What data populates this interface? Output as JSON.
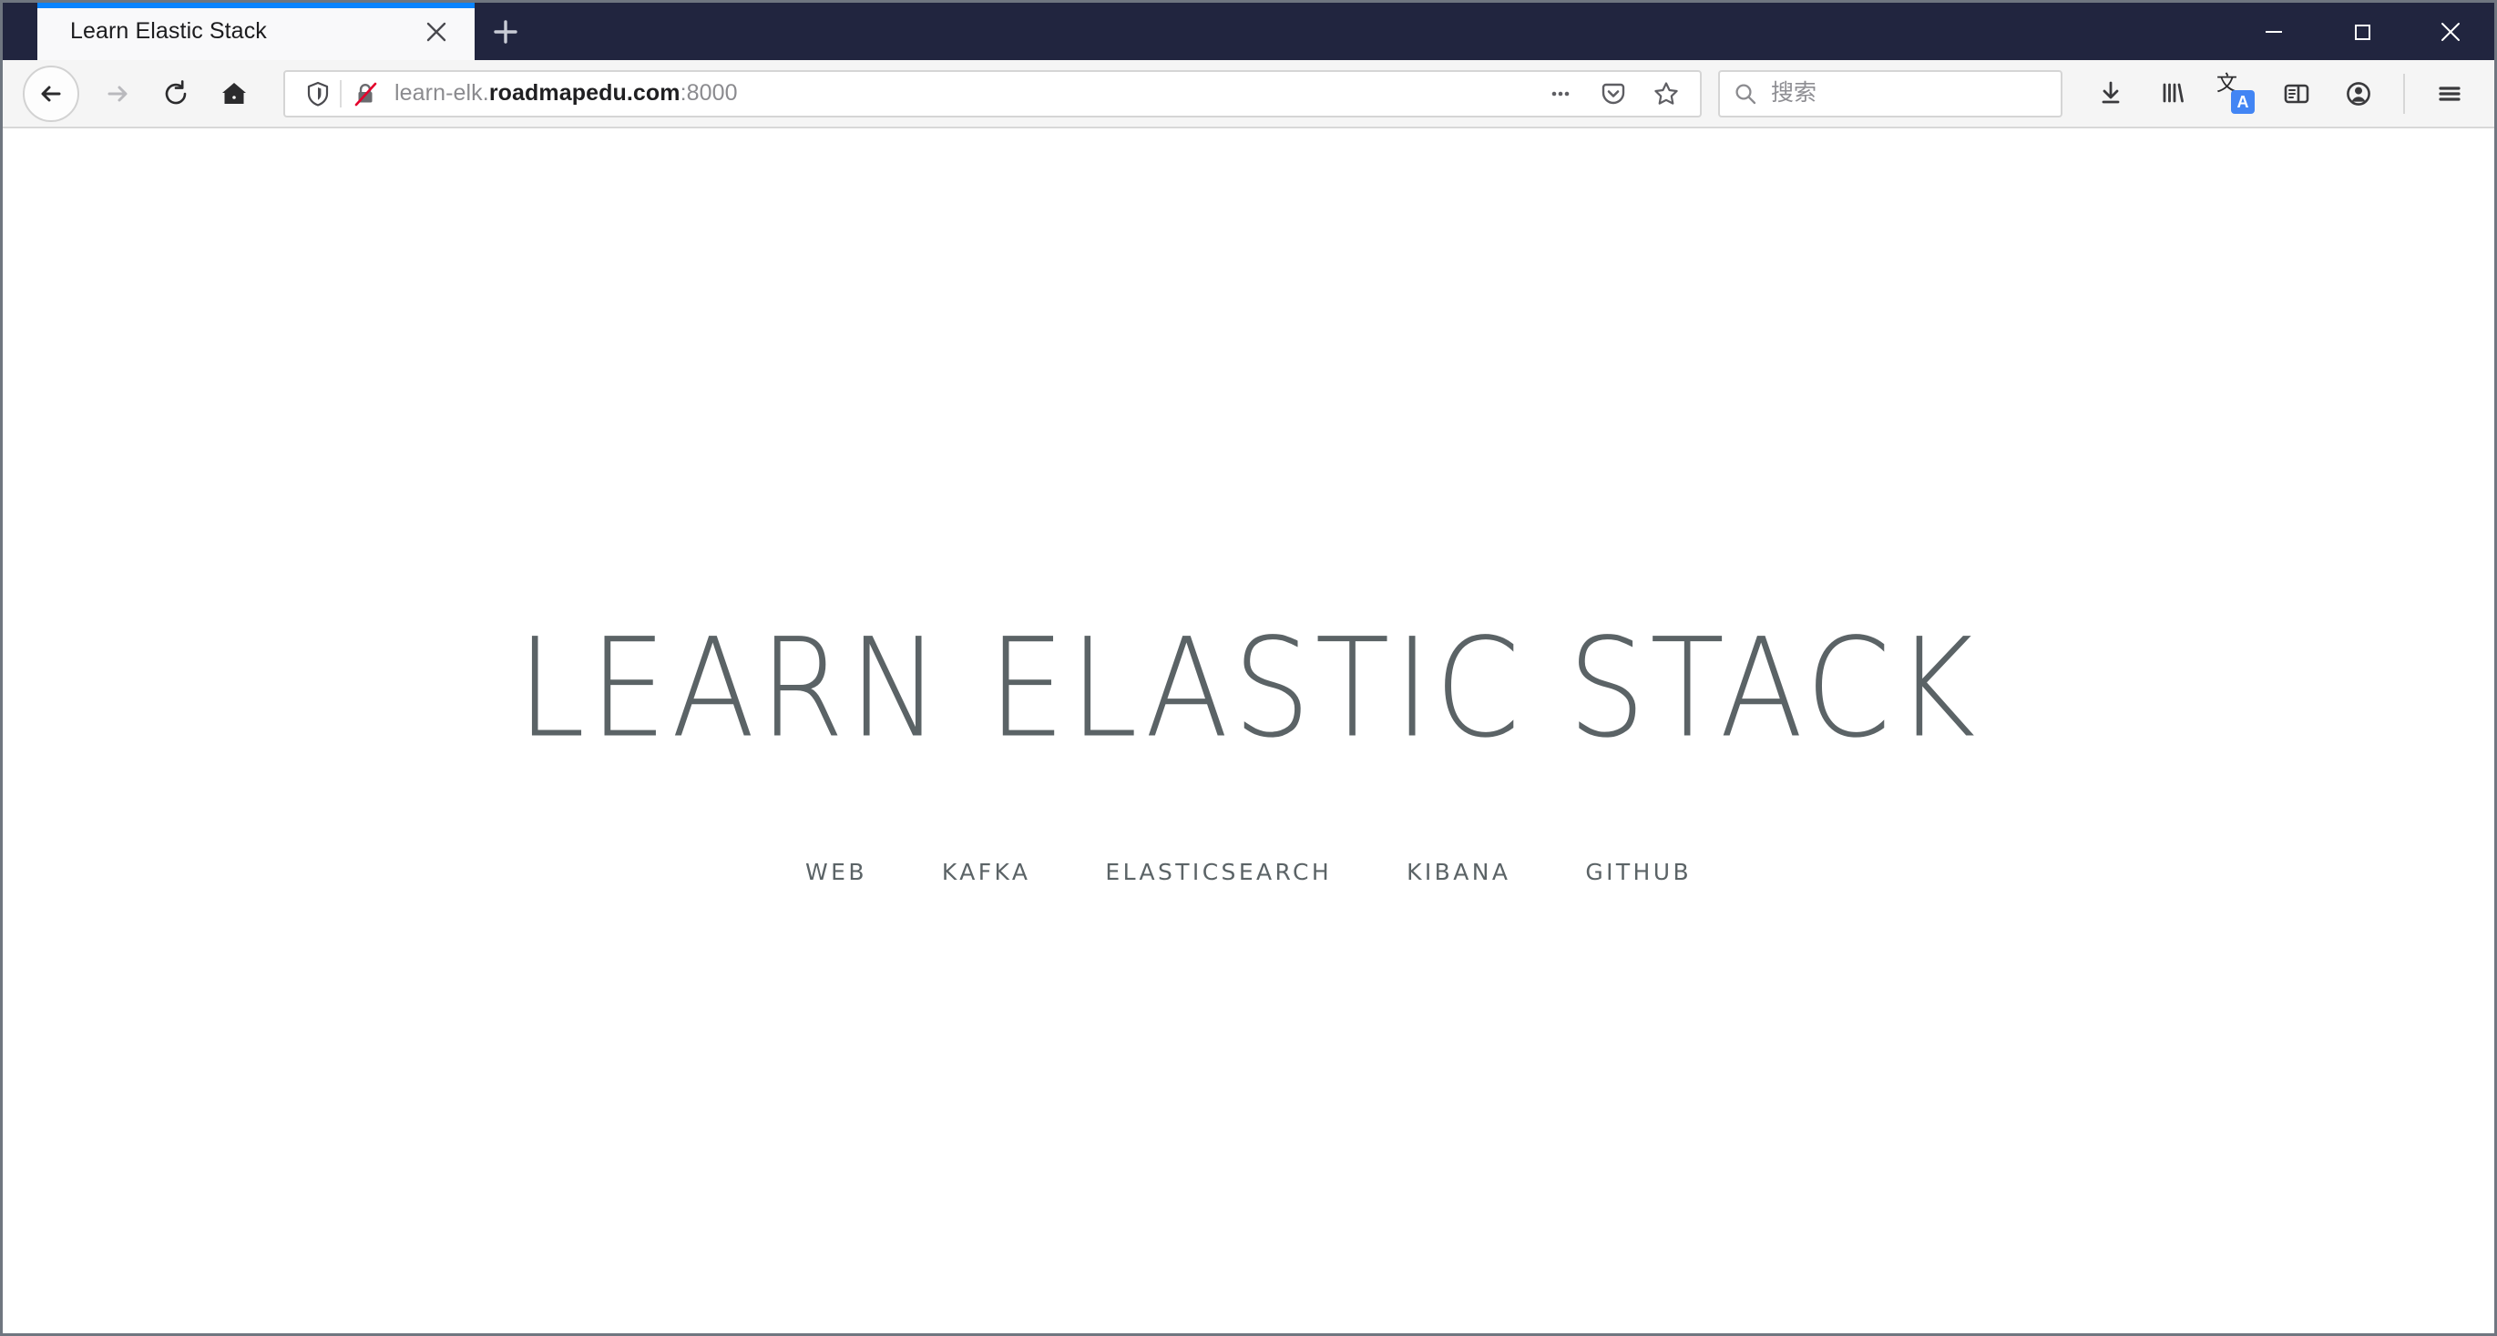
{
  "window": {
    "controls": [
      {
        "name": "minimize",
        "glyph": "minimize"
      },
      {
        "name": "maximize",
        "glyph": "maximize"
      },
      {
        "name": "close",
        "glyph": "close"
      }
    ],
    "chrome_color": "#21253f",
    "tab_accent_color": "#0a84ff"
  },
  "tabs": {
    "active": {
      "title": "Learn Elastic Stack",
      "close_label": "×"
    },
    "new_tab_label": "+"
  },
  "toolbar": {
    "back_label": "Back",
    "forward_label": "Forward",
    "reload_label": "Reload",
    "home_label": "Home",
    "downloads_label": "Downloads",
    "library_label": "Library",
    "translate_label": "Google Translate",
    "translate_cjk": "文",
    "translate_letter": "A",
    "sidebar_label": "Toggle Reader View",
    "account_label": "Account",
    "menu_label": "Open Application Menu"
  },
  "urlbar": {
    "tracking_protection_label": "Tracking Protection",
    "connection_label": "Connection is not secure",
    "prefix": "learn-elk.",
    "host": "roadmapedu.com",
    "suffix": ":8000",
    "full_url": "learn-elk.roadmapedu.com:8000",
    "page_actions_label": "Page actions",
    "pocket_label": "Save to Pocket",
    "bookmark_label": "Bookmark this page"
  },
  "search": {
    "placeholder": "搜索",
    "value": "",
    "icon": "search-icon"
  },
  "page": {
    "title": "LEARN ELASTIC STACK",
    "title_color": "#5b6366",
    "background": "#ffffff",
    "nav": [
      {
        "label": "WEB"
      },
      {
        "label": "KAFKA"
      },
      {
        "label": "ELASTICSEARCH"
      },
      {
        "label": "KIBANA"
      },
      {
        "label": "GITHUB"
      }
    ]
  }
}
